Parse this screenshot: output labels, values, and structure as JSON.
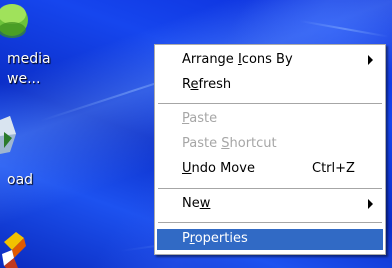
{
  "desktop": {
    "background_color": "#0b30d6",
    "icons": [
      {
        "label_line1": "media",
        "label_line2": "we...",
        "icon": "media-player-icon"
      },
      {
        "label_line1": "oad",
        "icon": "download-icon"
      },
      {
        "icon": "paint-icon"
      }
    ]
  },
  "context_menu": {
    "highlight_color": "#316ac5",
    "items": [
      {
        "prefix": "Arrange ",
        "accel": "I",
        "suffix": "cons By",
        "submenu": true,
        "enabled": true
      },
      {
        "prefix": "R",
        "accel": "e",
        "suffix": "fresh",
        "enabled": true
      },
      {
        "prefix": "",
        "accel": "P",
        "suffix": "aste",
        "enabled": false
      },
      {
        "prefix": "Paste ",
        "accel": "S",
        "suffix": "hortcut",
        "enabled": false
      },
      {
        "prefix": "",
        "accel": "U",
        "suffix": "ndo Move",
        "shortcut": "Ctrl+Z",
        "enabled": true
      },
      {
        "prefix": "Ne",
        "accel": "w",
        "suffix": "",
        "submenu": true,
        "enabled": true
      },
      {
        "prefix": "P",
        "accel": "r",
        "suffix": "operties",
        "enabled": true,
        "highlighted": true
      }
    ]
  }
}
